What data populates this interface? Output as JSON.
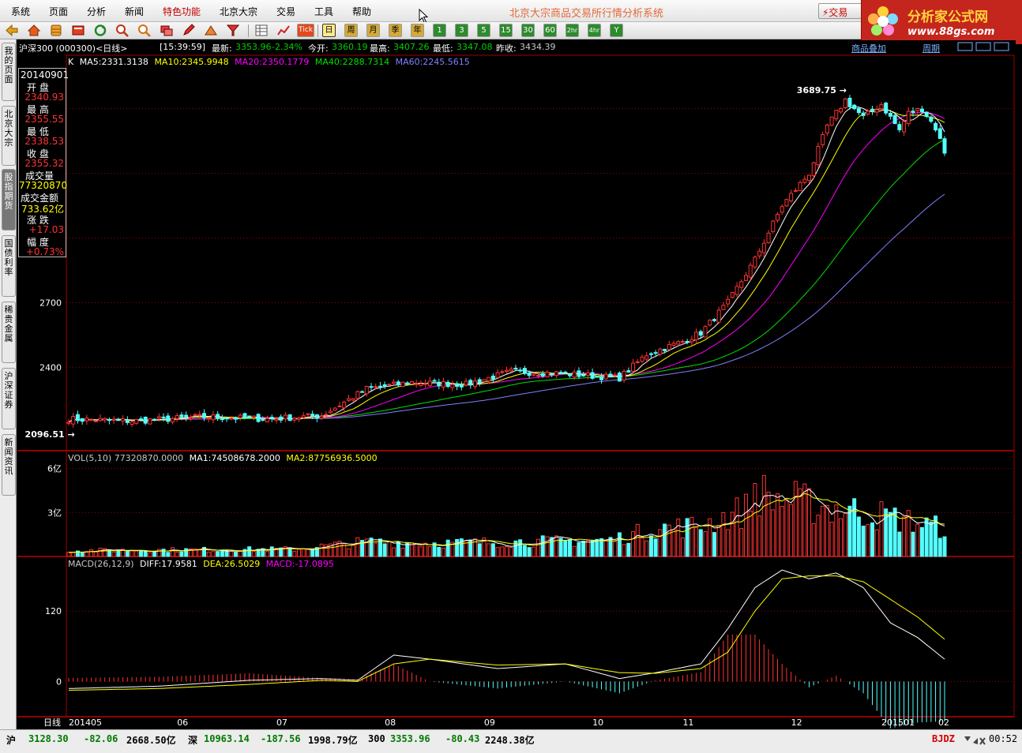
{
  "menu": {
    "items": [
      "系统",
      "页面",
      "分析",
      "新闻",
      "特色功能",
      "北京大宗",
      "交易",
      "工具",
      "帮助"
    ],
    "highlighted_index": 4,
    "app_title": "北京大宗商品交易所行情分析系统",
    "trade_button": "⚡交易"
  },
  "ad": {
    "line1": "分析家公式网",
    "line2": "www.88gs.com"
  },
  "toolbar": {
    "period_buttons": [
      "日",
      "周",
      "月",
      "季",
      "年"
    ],
    "selected_period": "日",
    "minute_buttons": [
      "1",
      "3",
      "5",
      "15",
      "30",
      "60",
      "2hr",
      "4hr",
      "Y"
    ],
    "tick_label": "Tick"
  },
  "infobar": {
    "instrument": "沪深300 (000300)<日线>",
    "time": "[15:39:59]",
    "latest_label": "最新:",
    "latest": "3353.96",
    "change": "-2.34%",
    "open_label": "今开:",
    "open": "3360.19",
    "high_label": "最高:",
    "high": "3407.26",
    "low_label": "最低:",
    "low": "3347.08",
    "prev_label": "昨收:",
    "prev": "3434.39",
    "overlay_link": "商品叠加",
    "period_link": "周期"
  },
  "sidetabs": [
    {
      "label": "我的页面",
      "active": false
    },
    {
      "label": "北京大宗",
      "active": false
    },
    {
      "label": "股指期货",
      "active": true
    },
    {
      "label": "国债利率",
      "active": false
    },
    {
      "label": "稀贵金属",
      "active": false
    },
    {
      "label": "沪深证券",
      "active": false
    },
    {
      "label": "新闻资讯",
      "active": false
    }
  ],
  "data_panel": {
    "date": "20140901",
    "open_label": "开 盘",
    "open": "2340.93",
    "high_label": "最 高",
    "high": "2355.55",
    "low_label": "最 低",
    "low": "2338.53",
    "close_label": "收 盘",
    "close": "2355.32",
    "volume_label": "成交量",
    "volume": "77320870",
    "amount_label": "成交金额",
    "amount": "733.62亿",
    "change_label": "涨 跌",
    "change": "+17.03",
    "pct_label": "幅 度",
    "pct": "+0.73%"
  },
  "legends": {
    "price": [
      {
        "text": "K",
        "color": "#ffffff"
      },
      {
        "text": "MA5:2331.3138",
        "color": "#ffffff"
      },
      {
        "text": "MA10:2345.9948",
        "color": "#ffff00"
      },
      {
        "text": "MA20:2350.1779",
        "color": "#ff00ff"
      },
      {
        "text": "MA40:2288.7314",
        "color": "#00e000"
      },
      {
        "text": "MA60:2245.5615",
        "color": "#8080ff"
      }
    ],
    "volume": [
      {
        "text": "VOL(5,10) 77320870.0000",
        "color": "#c8c8c8"
      },
      {
        "text": "MA1:74508678.2000",
        "color": "#ffffff"
      },
      {
        "text": "MA2:87756936.5000",
        "color": "#ffff00"
      }
    ],
    "macd": [
      {
        "text": "MACD(26,12,9)",
        "color": "#c8c8c8"
      },
      {
        "text": "DIFF:17.9581",
        "color": "#ffffff"
      },
      {
        "text": "DEA:26.5029",
        "color": "#ffff00"
      },
      {
        "text": "MACD:-17.0895",
        "color": "#ff00ff"
      }
    ]
  },
  "chart_data": [
    {
      "type": "candlestick",
      "title": "沪深300 (000300)<日线>",
      "y_ticks": [
        2400,
        2700
      ],
      "x_labels": [
        "日线",
        "201405",
        "06",
        "07",
        "08",
        "09",
        "10",
        "11",
        "12",
        "201501",
        "02"
      ],
      "annotations": [
        {
          "text": "3689.75",
          "kind": "period-high"
        },
        {
          "text": "2096.51",
          "kind": "period-low"
        }
      ],
      "close_anchors": [
        [
          0,
          2160
        ],
        [
          14,
          2150
        ],
        [
          30,
          2170
        ],
        [
          44,
          2160
        ],
        [
          56,
          2175
        ],
        [
          66,
          2300
        ],
        [
          76,
          2330
        ],
        [
          88,
          2320
        ],
        [
          98,
          2380
        ],
        [
          110,
          2370
        ],
        [
          122,
          2350
        ],
        [
          128,
          2460
        ],
        [
          136,
          2520
        ],
        [
          140,
          2560
        ],
        [
          146,
          2700
        ],
        [
          152,
          2900
        ],
        [
          158,
          3150
        ],
        [
          164,
          3300
        ],
        [
          168,
          3520
        ],
        [
          172,
          3640
        ],
        [
          176,
          3560
        ],
        [
          180,
          3620
        ],
        [
          184,
          3500
        ],
        [
          186,
          3580
        ],
        [
          189,
          3600
        ],
        [
          192,
          3510
        ],
        [
          194,
          3400
        ]
      ],
      "series": [
        "K",
        "MA5",
        "MA10",
        "MA20",
        "MA40",
        "MA60"
      ]
    },
    {
      "type": "bar",
      "title": "VOL(5,10)",
      "y_ticks_labels": [
        "3亿",
        "6亿"
      ],
      "y_ticks": [
        3,
        6
      ],
      "unit": "亿",
      "volume_anchors": [
        [
          0,
          0.4
        ],
        [
          50,
          0.5
        ],
        [
          66,
          1.0
        ],
        [
          80,
          0.9
        ],
        [
          100,
          1.0
        ],
        [
          120,
          1.1
        ],
        [
          130,
          1.9
        ],
        [
          140,
          2.1
        ],
        [
          150,
          3.2
        ],
        [
          152,
          4.6
        ],
        [
          155,
          4.0
        ],
        [
          160,
          3.8
        ],
        [
          165,
          3.5
        ],
        [
          170,
          3.3
        ],
        [
          180,
          2.8
        ],
        [
          194,
          1.9
        ]
      ]
    },
    {
      "type": "line",
      "title": "MACD(26,12,9)",
      "y_ticks": [
        0,
        120
      ],
      "diff_anchors": [
        [
          0,
          -12
        ],
        [
          20,
          -8
        ],
        [
          40,
          2
        ],
        [
          56,
          5
        ],
        [
          64,
          2
        ],
        [
          72,
          45
        ],
        [
          80,
          38
        ],
        [
          95,
          22
        ],
        [
          110,
          30
        ],
        [
          122,
          5
        ],
        [
          130,
          15
        ],
        [
          140,
          30
        ],
        [
          146,
          90
        ],
        [
          152,
          160
        ],
        [
          158,
          190
        ],
        [
          164,
          175
        ],
        [
          170,
          185
        ],
        [
          176,
          160
        ],
        [
          182,
          100
        ],
        [
          188,
          75
        ],
        [
          194,
          38
        ]
      ],
      "dea_anchors": [
        [
          0,
          -15
        ],
        [
          20,
          -12
        ],
        [
          40,
          -5
        ],
        [
          56,
          2
        ],
        [
          64,
          0
        ],
        [
          72,
          30
        ],
        [
          80,
          38
        ],
        [
          95,
          28
        ],
        [
          110,
          30
        ],
        [
          122,
          15
        ],
        [
          130,
          14
        ],
        [
          140,
          22
        ],
        [
          146,
          50
        ],
        [
          152,
          120
        ],
        [
          158,
          175
        ],
        [
          164,
          180
        ],
        [
          170,
          180
        ],
        [
          176,
          170
        ],
        [
          182,
          140
        ],
        [
          188,
          110
        ],
        [
          194,
          72
        ]
      ]
    }
  ],
  "statusbar": {
    "sh_label": "沪",
    "sh_value": "3128.30",
    "sh_change": "-82.06",
    "sh_amount": "2668.50亿",
    "sz_label": "深",
    "sz_value": "10963.14",
    "sz_change": "-187.56",
    "sz_amount": "1998.79亿",
    "hs_label": "300",
    "hs_value": "3353.96",
    "hs_change": "-80.43",
    "hs_amount": "2248.38亿",
    "brand": "BJDZ",
    "clock": "00:52"
  }
}
